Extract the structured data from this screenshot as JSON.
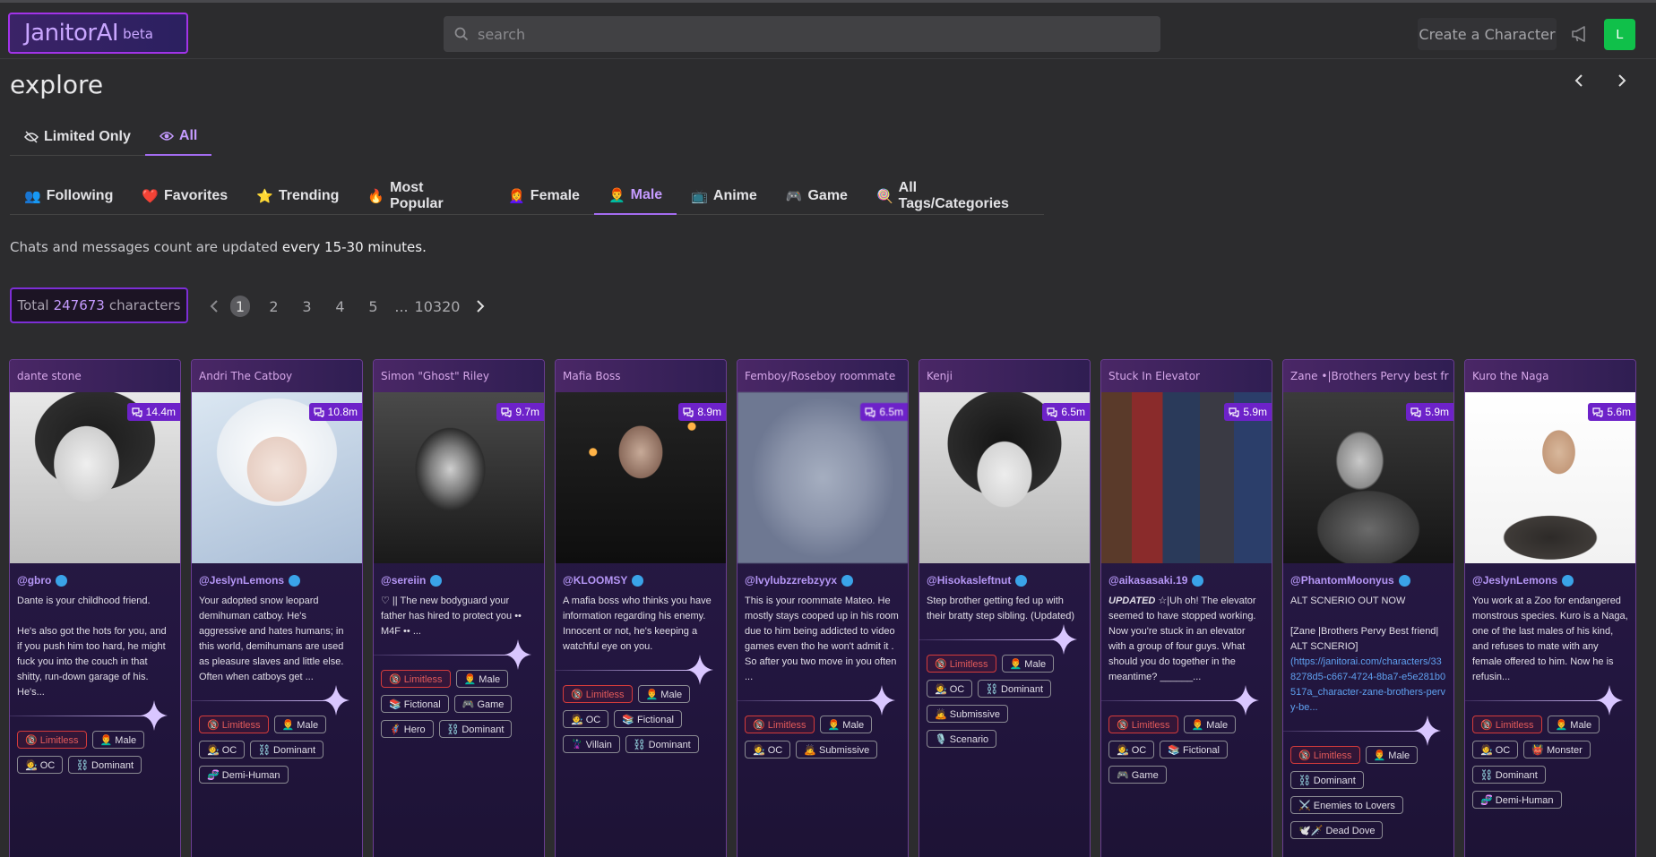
{
  "header": {
    "logo_name": "JanitorAI",
    "logo_beta": "beta",
    "search_placeholder": "search",
    "create_label": "Create a Character",
    "avatar_letter": "L"
  },
  "explore": {
    "title": "explore",
    "filter_tabs": [
      {
        "label": "Limited Only",
        "icon": "eye-slash-icon"
      },
      {
        "label": "All",
        "icon": "eye-icon"
      }
    ],
    "category_tabs": [
      {
        "icon": "👥",
        "label": "Following"
      },
      {
        "icon": "❤️",
        "label": "Favorites"
      },
      {
        "icon": "⭐",
        "label": "Trending"
      },
      {
        "icon": "🔥",
        "label": "Most Popular"
      },
      {
        "icon": "👩‍🦰",
        "label": "Female"
      },
      {
        "icon": "👨‍🦰",
        "label": "Male"
      },
      {
        "icon": "📺",
        "label": "Anime"
      },
      {
        "icon": "🎮",
        "label": "Game"
      },
      {
        "icon": "🍭",
        "label": "All Tags/Categories"
      }
    ],
    "active_category": "Male",
    "note_prefix": "Chats and messages count are updated ",
    "note_bold": "every 15-30 minutes.",
    "total_prefix": "Total",
    "total_count": "247673",
    "total_suffix": "characters",
    "pages": [
      "1",
      "2",
      "3",
      "4",
      "5"
    ],
    "page_dots": "...",
    "last_page": "10320"
  },
  "colors": {
    "accent": "#a36cf0",
    "brand": "#a233e8",
    "badge": "#6d22c9",
    "limitless": "#d43b3b",
    "online": "#10c04a"
  },
  "cards": [
    {
      "name": "dante stone",
      "count": "14.4m",
      "author": "@gbro",
      "desc": [
        "Dante is your childhood friend.",
        "",
        "He's also got the hots for you, and if you push him too hard, he might fuck you into the couch in that shitty, run-down garage of his. He's..."
      ],
      "tags": [
        "🔞 Limitless",
        "👨‍🦰 Male",
        "🧑‍🎨 OC",
        "⛓️ Dominant"
      ],
      "img": "manga"
    },
    {
      "name": "Andri The Catboy",
      "count": "10.8m",
      "author": "@JeslynLemons",
      "desc": [
        "Your adopted snow leopard demihuman catboy. He's aggressive and hates humans; in this world, demihumans are used as pleasure slaves and little else. Often when catboys get ..."
      ],
      "tags": [
        "🔞 Limitless",
        "👨‍🦰 Male",
        "🧑‍🎨 OC",
        "⛓️ Dominant",
        "🧬 Demi-Human"
      ],
      "img": "catboy"
    },
    {
      "name": "Simon \"Ghost\" Riley",
      "count": "9.7m",
      "author": "@sereiin",
      "desc": [
        "♡ || The new bodyguard your father has hired to protect you   ••  M4F ••                                    ..."
      ],
      "tags": [
        "🔞 Limitless",
        "👨‍🦰 Male",
        "📚 Fictional",
        "🎮 Game",
        "🦸 Hero",
        "⛓️ Dominant"
      ],
      "img": "ghost"
    },
    {
      "name": "Mafia Boss",
      "count": "8.9m",
      "author": "@KLOOMSY",
      "desc": [
        "A mafia boss who thinks you have information regarding his enemy. Innocent or not, he's keeping a watchful eye on you."
      ],
      "tags": [
        "🔞 Limitless",
        "👨‍🦰 Male",
        "🧑‍🎨 OC",
        "📚 Fictional",
        "🦹 Villain",
        "⛓️ Dominant"
      ],
      "img": "mafia"
    },
    {
      "name": "Femboy/Roseboy roommate",
      "count": "6.5m",
      "author": "@lvylubzzrebzyyx",
      "desc": [
        "This is your roommate Mateo. He mostly stays cooped up in his room due to him being addicted to video games even tho he won't admit it . So after you two move in you often ..."
      ],
      "tags": [
        "🔞 Limitless",
        "👨‍🦰 Male",
        "🧑‍🎨 OC",
        "🙇 Submissive"
      ],
      "img": "blur"
    },
    {
      "name": "Kenji",
      "count": "6.5m",
      "author": "@Hisokasleftnut",
      "desc": [
        "Step brother getting fed up with their bratty step sibling. (Updated)"
      ],
      "tags": [
        "🔞 Limitless",
        "👨‍🦰 Male",
        "🧑‍🎨 OC",
        "⛓️ Dominant",
        "🙇 Submissive",
        "🎙️ Scenario"
      ],
      "img": "kenji"
    },
    {
      "name": "Stuck In Elevator",
      "count": "5.9m",
      "author": "@aikasasaki.19",
      "desc_lead": "UPDATED",
      "desc": [
        " ☆|Uh oh! The elevator seemed to have stopped working. Now you're stuck in an elevator with a group of four guys. What should you do together in the meantime? ______..."
      ],
      "tags": [
        "🔞 Limitless",
        "👨‍🦰 Male",
        "🧑‍🎨 OC",
        "📚 Fictional",
        "🎮 Game"
      ],
      "img": "group"
    },
    {
      "name": "Zane •|Brothers Pervy best fr",
      "count": "5.9m",
      "author": "@PhantomMoonyus",
      "desc": [
        "ALT SCNERIO OUT NOW",
        "",
        "[Zane |Brothers Pervy Best friend| ALT SCNERIO]"
      ],
      "link": "(https://janitorai.com/characters/338278d5-c667-4724-8ba7-e5e281b0517a_character-zane-brothers-pervy-be...",
      "tags": [
        "🔞 Limitless",
        "👨‍🦰 Male",
        "⛓️ Dominant",
        "⚔️ Enemies to Lovers",
        "🕊️🗡️ Dead Dove"
      ],
      "img": "zane"
    },
    {
      "name": "Kuro the Naga",
      "count": "5.6m",
      "author": "@JeslynLemons",
      "desc": [
        "You work at a Zoo for endangered monstrous species. Kuro is a Naga, one of the last males of his kind, and refuses to mate with any female offered to him. Now he is refusin..."
      ],
      "tags": [
        "🔞 Limitless",
        "👨‍🦰 Male",
        "🧑‍🎨 OC",
        "👹 Monster",
        "⛓️ Dominant",
        "🧬 Demi-Human"
      ],
      "img": "naga"
    }
  ]
}
